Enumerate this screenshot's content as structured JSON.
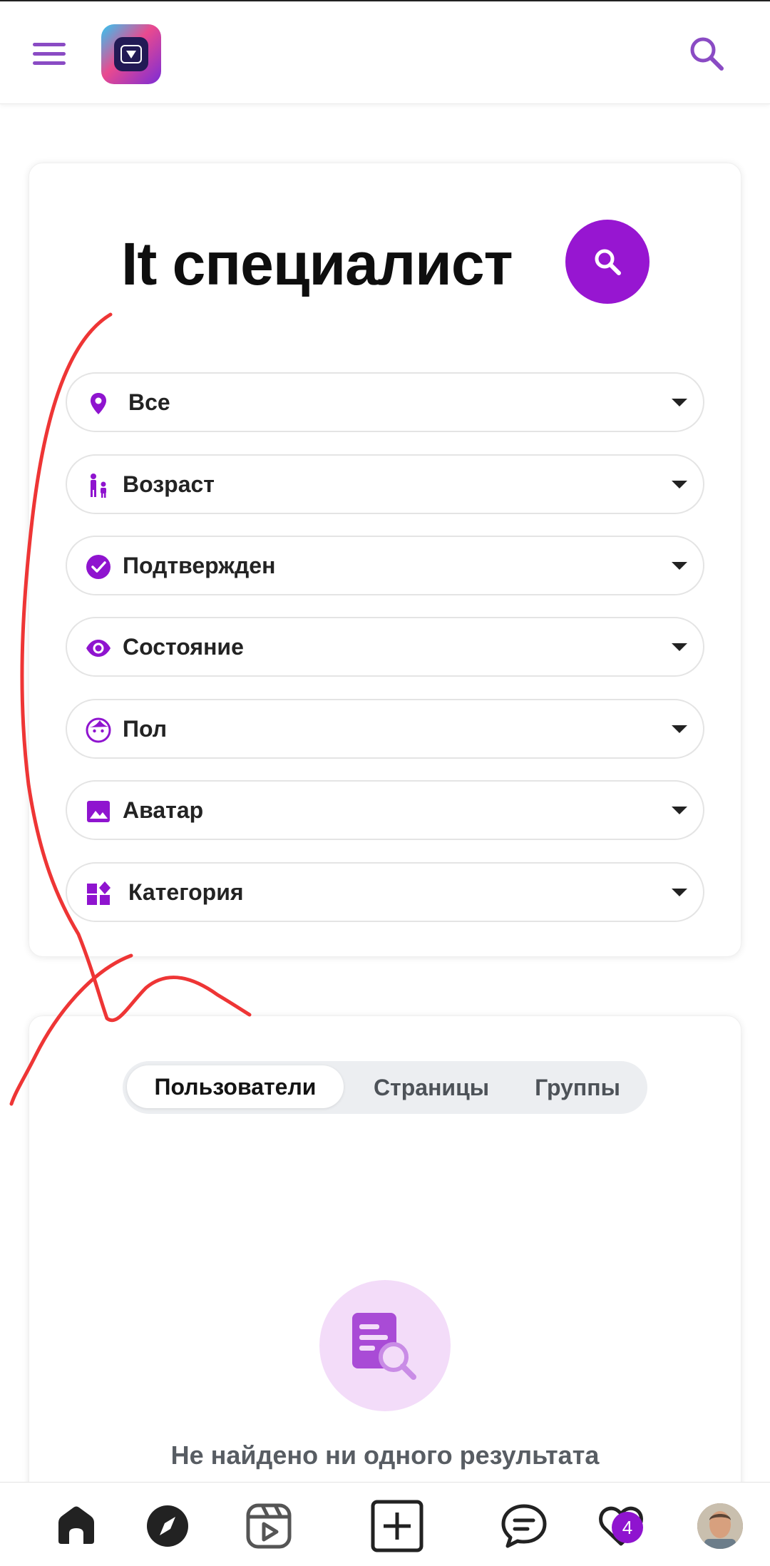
{
  "header": {
    "menu_icon": "hamburger-menu-icon",
    "logo_icon": "app-logo-icon",
    "search_icon": "search-icon"
  },
  "search_card": {
    "title": "It специалист",
    "filters": [
      {
        "icon": "location-pin-icon",
        "label": "Все"
      },
      {
        "icon": "family-icon",
        "label": "Возраст"
      },
      {
        "icon": "verified-check-icon",
        "label": "Подтвержден"
      },
      {
        "icon": "eye-icon",
        "label": "Состояние"
      },
      {
        "icon": "face-icon",
        "label": "Пол"
      },
      {
        "icon": "image-icon",
        "label": "Аватар"
      },
      {
        "icon": "category-icon",
        "label": "Категория"
      }
    ]
  },
  "results_card": {
    "tabs": [
      {
        "label": "Пользователи",
        "active": true
      },
      {
        "label": "Страницы",
        "active": false
      },
      {
        "label": "Группы",
        "active": false
      }
    ],
    "empty_message": "Не найдено ни одного результата"
  },
  "bottom_nav": {
    "items": [
      "home-icon",
      "explore-compass-icon",
      "reels-icon",
      "add-post-icon",
      "messages-icon",
      "notifications-heart-icon",
      "profile-avatar"
    ],
    "notification_count": "4"
  },
  "colors": {
    "accent": "#9716d1",
    "menu_purple": "#8a4bc4",
    "annotation_red": "#ee3535"
  }
}
